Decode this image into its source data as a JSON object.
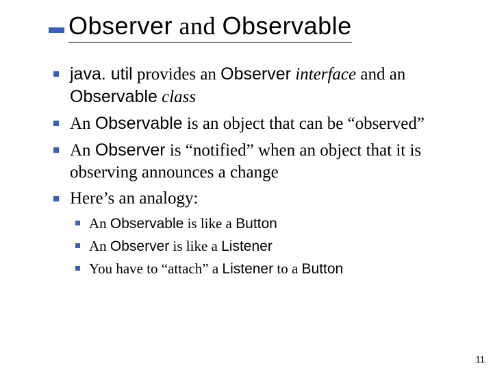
{
  "title": {
    "part1": "Observer",
    "conj": " and ",
    "part2": "Observable"
  },
  "bullets": [
    {
      "runs": [
        {
          "t": "java. util",
          "cls": "sans"
        },
        {
          "t": " provides an ",
          "cls": ""
        },
        {
          "t": "Observer",
          "cls": "sans"
        },
        {
          "t": " interface",
          "cls": "serif-ital"
        },
        {
          "t": " and an ",
          "cls": ""
        },
        {
          "t": "Observable",
          "cls": "sans"
        },
        {
          "t": " class",
          "cls": "serif-ital"
        }
      ]
    },
    {
      "runs": [
        {
          "t": "An ",
          "cls": ""
        },
        {
          "t": "Observable",
          "cls": "sans"
        },
        {
          "t": " is an object that can be “observed”",
          "cls": ""
        }
      ]
    },
    {
      "runs": [
        {
          "t": "An ",
          "cls": ""
        },
        {
          "t": "Observer",
          "cls": "sans"
        },
        {
          "t": " is “notified” when an object that it is observing announces a change",
          "cls": ""
        }
      ]
    },
    {
      "runs": [
        {
          "t": "Here’s an analogy:",
          "cls": ""
        }
      ],
      "sub": [
        {
          "runs": [
            {
              "t": "An ",
              "cls": ""
            },
            {
              "t": "Observable",
              "cls": "sans"
            },
            {
              "t": " is like a ",
              "cls": ""
            },
            {
              "t": "Button",
              "cls": "sans"
            }
          ]
        },
        {
          "runs": [
            {
              "t": "An ",
              "cls": ""
            },
            {
              "t": "Observer",
              "cls": "sans"
            },
            {
              "t": " is like a ",
              "cls": ""
            },
            {
              "t": "Listener",
              "cls": "sans"
            }
          ]
        },
        {
          "runs": [
            {
              "t": "You have to “attach” a ",
              "cls": ""
            },
            {
              "t": "Listener",
              "cls": "sans"
            },
            {
              "t": " to a ",
              "cls": ""
            },
            {
              "t": "Button",
              "cls": "sans"
            }
          ]
        }
      ]
    }
  ],
  "page_number": "11"
}
